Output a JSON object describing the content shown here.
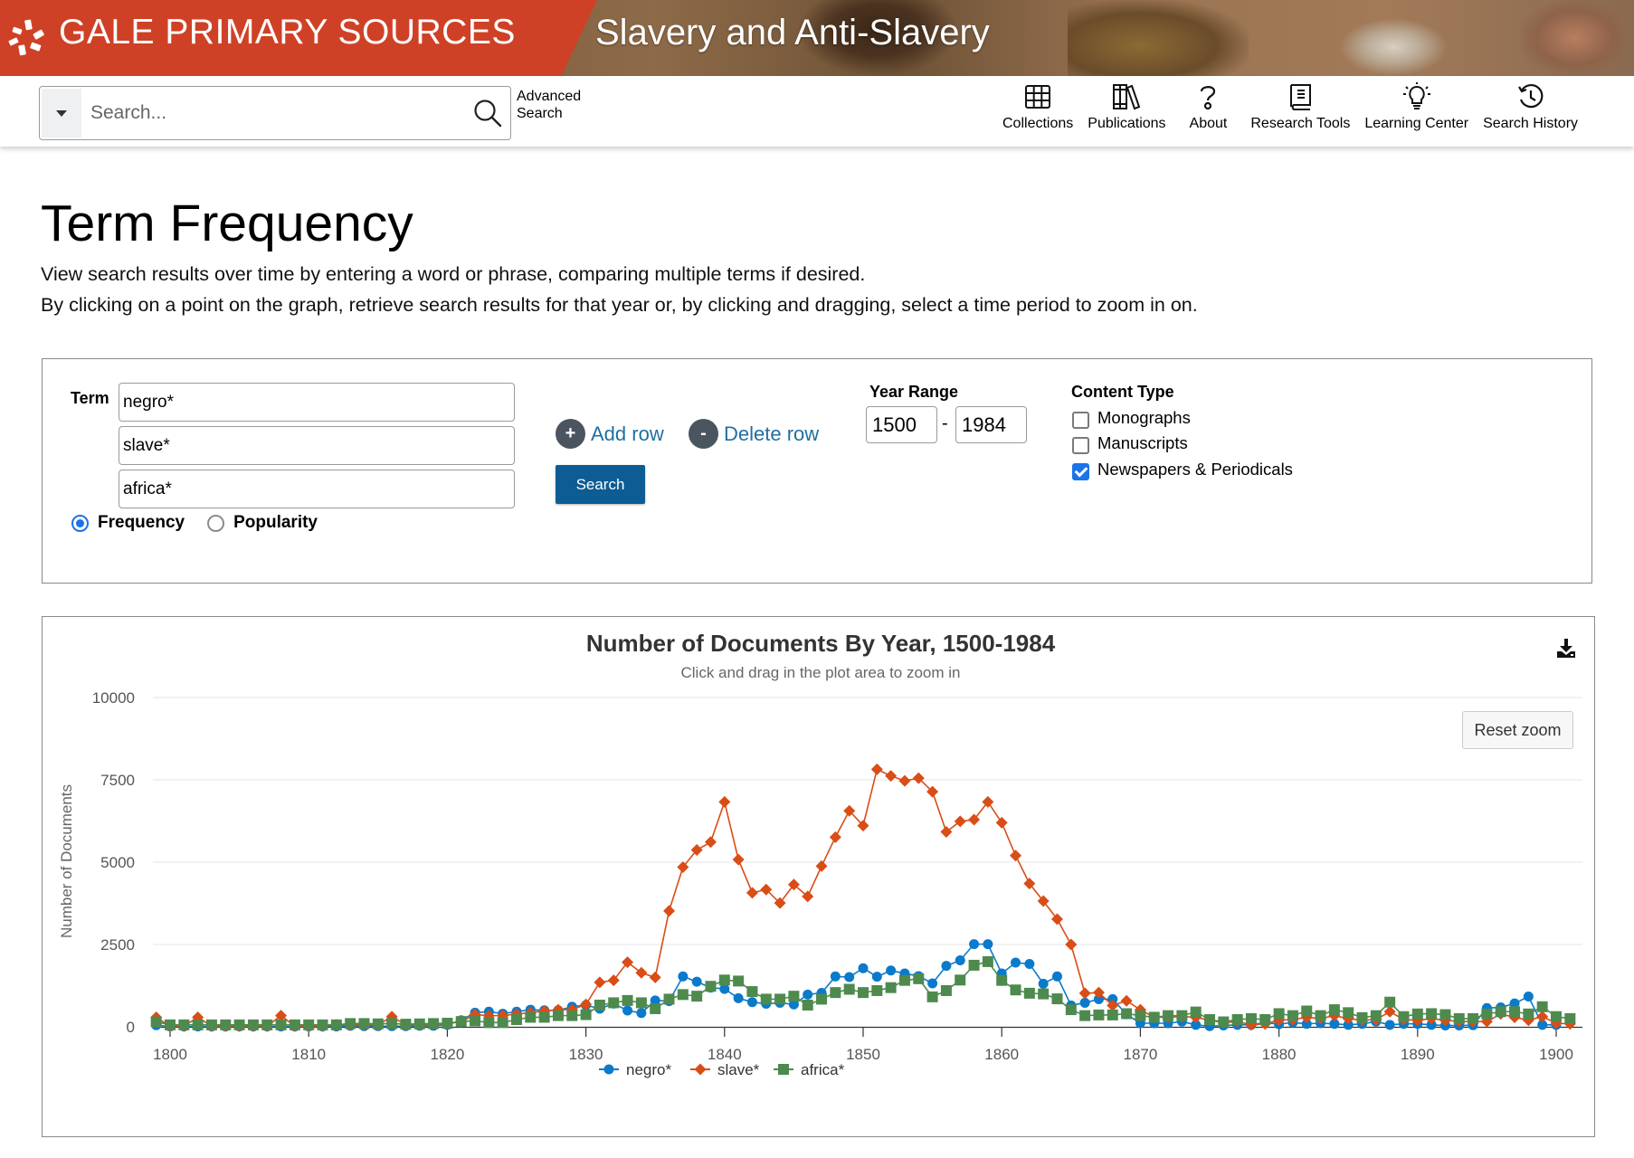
{
  "header": {
    "brand": "GALE PRIMARY SOURCES",
    "collection_title": "Slavery and Anti-Slavery",
    "brand_color": "#cf4126"
  },
  "nav": {
    "search_placeholder": "Search...",
    "search_value": "",
    "advanced_search_line1": "Advanced",
    "advanced_search_line2": "Search",
    "items": [
      {
        "label": "Collections",
        "icon": "grid-icon"
      },
      {
        "label": "Publications",
        "icon": "books-icon"
      },
      {
        "label": "About",
        "icon": "question-icon"
      },
      {
        "label": "Research Tools",
        "icon": "book-icon"
      },
      {
        "label": "Learning Center",
        "icon": "lightbulb-icon"
      },
      {
        "label": "Search History",
        "icon": "history-icon"
      }
    ]
  },
  "page": {
    "title": "Term Frequency",
    "description_1": "View search results over time by entering a word or phrase, comparing multiple terms if desired.",
    "description_2": "By clicking on a point on the graph, retrieve search results for that year or, by clicking and dragging, select a time period to zoom in on."
  },
  "form": {
    "term_label": "Term",
    "terms": [
      "negro*",
      "slave*",
      "africa*"
    ],
    "mode_options": [
      {
        "label": "Frequency",
        "checked": true
      },
      {
        "label": "Popularity",
        "checked": false
      }
    ],
    "add_row": "Add row",
    "add_row_glyph": "+",
    "delete_row": "Delete row",
    "delete_row_glyph": "-",
    "search_button": "Search",
    "year_range_label": "Year Range",
    "year_from": "1500",
    "year_to": "1984",
    "year_separator": "-",
    "content_type_label": "Content Type",
    "content_types": [
      {
        "label": "Monographs",
        "checked": false
      },
      {
        "label": "Manuscripts",
        "checked": false
      },
      {
        "label": "Newspapers & Periodicals",
        "checked": true
      }
    ]
  },
  "chart_controls": {
    "reset_zoom": "Reset zoom",
    "export_icon": "download-icon"
  },
  "chart_data": {
    "type": "line",
    "title": "Number of Documents By Year, 1500-1984",
    "subtitle": "Click and drag in the plot area to zoom in",
    "xlabel": "",
    "ylabel": "Number of Documents",
    "xlim": [
      1799,
      1901
    ],
    "ylim": [
      0,
      10000
    ],
    "x_ticks": [
      1800,
      1810,
      1820,
      1830,
      1840,
      1850,
      1860,
      1870,
      1880,
      1890,
      1900
    ],
    "y_ticks": [
      0,
      2500,
      5000,
      7500,
      10000
    ],
    "grid": true,
    "legend_position": "bottom-center",
    "x_start": 1799,
    "series": [
      {
        "name": "negro*",
        "color": "#0a7acb",
        "marker": "circle",
        "values": [
          50,
          10,
          10,
          10,
          10,
          10,
          10,
          10,
          10,
          10,
          10,
          10,
          10,
          10,
          30,
          20,
          20,
          20,
          20,
          30,
          30,
          60,
          200,
          430,
          460,
          400,
          460,
          520,
          500,
          500,
          610,
          660,
          550,
          705,
          495,
          420,
          800,
          780,
          1530,
          1370,
          1190,
          1150,
          870,
          750,
          700,
          730,
          680,
          980,
          1030,
          1530,
          1510,
          1780,
          1520,
          1710,
          1620,
          1540,
          1320,
          1850,
          2020,
          2510,
          2510,
          1620,
          1950,
          1910,
          1310,
          1530,
          650,
          730,
          840,
          840,
          380,
          110,
          110,
          110,
          160,
          60,
          20,
          40,
          60,
          60,
          130,
          80,
          130,
          90,
          110,
          90,
          60,
          90,
          160,
          60,
          90,
          90,
          60,
          40,
          40,
          50,
          570,
          590,
          710,
          920,
          60,
          60
        ]
      },
      {
        "name": "slave*",
        "color": "#d94d16",
        "marker": "diamond",
        "values": [
          290,
          20,
          20,
          290,
          20,
          20,
          20,
          20,
          20,
          340,
          20,
          20,
          20,
          60,
          60,
          60,
          60,
          310,
          60,
          60,
          80,
          100,
          150,
          370,
          340,
          340,
          385,
          430,
          480,
          520,
          520,
          680,
          1350,
          1410,
          1960,
          1640,
          1500,
          3520,
          4850,
          5370,
          5610,
          6830,
          5080,
          4070,
          4170,
          3760,
          4320,
          3960,
          4880,
          5760,
          6560,
          6110,
          7820,
          7620,
          7470,
          7550,
          7140,
          5920,
          6240,
          6290,
          6830,
          6200,
          5200,
          4350,
          3820,
          3270,
          2500,
          1020,
          1040,
          650,
          790,
          520,
          290,
          290,
          310,
          290,
          200,
          130,
          160,
          60,
          90,
          200,
          220,
          290,
          250,
          340,
          250,
          200,
          220,
          460,
          220,
          200,
          250,
          200,
          160,
          160,
          160,
          390,
          290,
          200,
          310,
          110,
          90
        ]
      },
      {
        "name": "africa*",
        "color": "#4e8a4e",
        "marker": "square",
        "values": [
          150,
          60,
          60,
          60,
          60,
          60,
          60,
          60,
          60,
          60,
          60,
          60,
          60,
          60,
          100,
          100,
          90,
          100,
          80,
          90,
          100,
          110,
          160,
          180,
          130,
          130,
          220,
          290,
          290,
          340,
          340,
          370,
          660,
          730,
          800,
          730,
          550,
          840,
          980,
          930,
          1230,
          1420,
          1390,
          1070,
          840,
          840,
          930,
          660,
          840,
          1040,
          1140,
          1040,
          1100,
          1190,
          1410,
          1460,
          910,
          1100,
          1420,
          1870,
          1980,
          1410,
          1120,
          1020,
          1000,
          850,
          520,
          340,
          360,
          360,
          400,
          340,
          290,
          340,
          340,
          450,
          220,
          150,
          220,
          250,
          220,
          400,
          340,
          480,
          340,
          520,
          430,
          280,
          340,
          750,
          310,
          390,
          400,
          370,
          250,
          250,
          390,
          460,
          460,
          390,
          610,
          310,
          250
        ]
      }
    ]
  }
}
